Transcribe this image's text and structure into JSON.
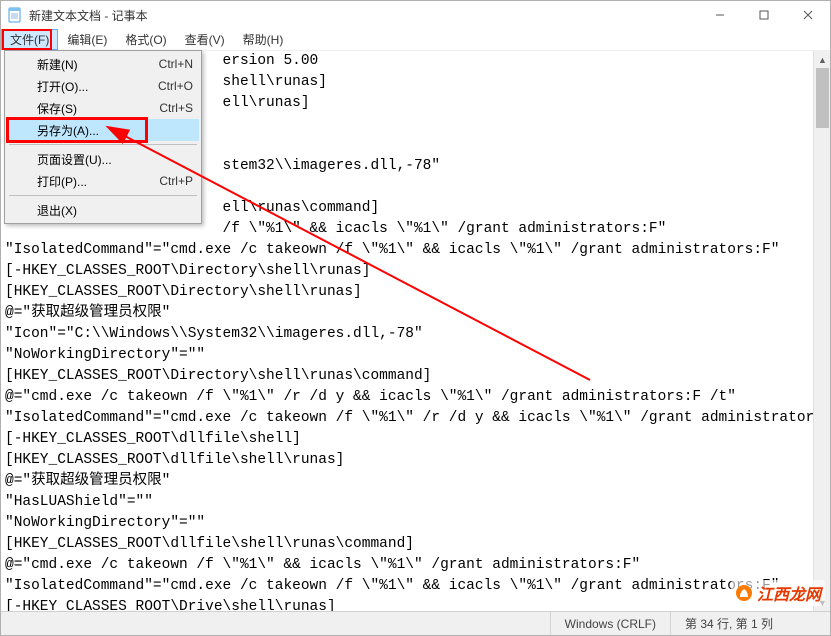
{
  "window": {
    "title": "新建文本文档 - 记事本"
  },
  "menubar": {
    "items": [
      {
        "label": "文件(F)",
        "active": true
      },
      {
        "label": "编辑(E)"
      },
      {
        "label": "格式(O)"
      },
      {
        "label": "查看(V)"
      },
      {
        "label": "帮助(H)"
      }
    ]
  },
  "filemenu": {
    "items": [
      {
        "label": "新建(N)",
        "shortcut": "Ctrl+N"
      },
      {
        "label": "打开(O)...",
        "shortcut": "Ctrl+O"
      },
      {
        "label": "保存(S)",
        "shortcut": "Ctrl+S"
      },
      {
        "label": "另存为(A)...",
        "shortcut": "",
        "hover": true
      },
      {
        "sep": true
      },
      {
        "label": "页面设置(U)...",
        "shortcut": ""
      },
      {
        "label": "打印(P)...",
        "shortcut": "Ctrl+P"
      },
      {
        "sep": true
      },
      {
        "label": "退出(X)",
        "shortcut": ""
      }
    ]
  },
  "editor": {
    "lines": [
      "                         ersion 5.00",
      "                         shell\\runas]",
      "                         ell\\runas]",
      "",
      "",
      "                         stem32\\\\imageres.dll,-78\"",
      "",
      "                         ell\\runas\\command]",
      "                         /f \\\"%1\\\" && icacls \\\"%1\\\" /grant administrators:F\"",
      "\"IsolatedCommand\"=\"cmd.exe /c takeown /f \\\"%1\\\" && icacls \\\"%1\\\" /grant administrators:F\"",
      "[-HKEY_CLASSES_ROOT\\Directory\\shell\\runas]",
      "[HKEY_CLASSES_ROOT\\Directory\\shell\\runas]",
      "@=\"获取超级管理员权限\"",
      "\"Icon\"=\"C:\\\\Windows\\\\System32\\\\imageres.dll,-78\"",
      "\"NoWorkingDirectory\"=\"\"",
      "[HKEY_CLASSES_ROOT\\Directory\\shell\\runas\\command]",
      "@=\"cmd.exe /c takeown /f \\\"%1\\\" /r /d y && icacls \\\"%1\\\" /grant administrators:F /t\"",
      "\"IsolatedCommand\"=\"cmd.exe /c takeown /f \\\"%1\\\" /r /d y && icacls \\\"%1\\\" /grant administrators:F /t\"",
      "[-HKEY_CLASSES_ROOT\\dllfile\\shell]",
      "[HKEY_CLASSES_ROOT\\dllfile\\shell\\runas]",
      "@=\"获取超级管理员权限\"",
      "\"HasLUAShield\"=\"\"",
      "\"NoWorkingDirectory\"=\"\"",
      "[HKEY_CLASSES_ROOT\\dllfile\\shell\\runas\\command]",
      "@=\"cmd.exe /c takeown /f \\\"%1\\\" && icacls \\\"%1\\\" /grant administrators:F\"",
      "\"IsolatedCommand\"=\"cmd.exe /c takeown /f \\\"%1\\\" && icacls \\\"%1\\\" /grant administrators:F\"",
      "[-HKEY_CLASSES_ROOT\\Drive\\shell\\runas]"
    ]
  },
  "statusbar": {
    "encoding_mode": "Windows (CRLF)",
    "cursor": "第 34 行, 第 1 列"
  },
  "watermark": {
    "text": "江西龙网"
  }
}
